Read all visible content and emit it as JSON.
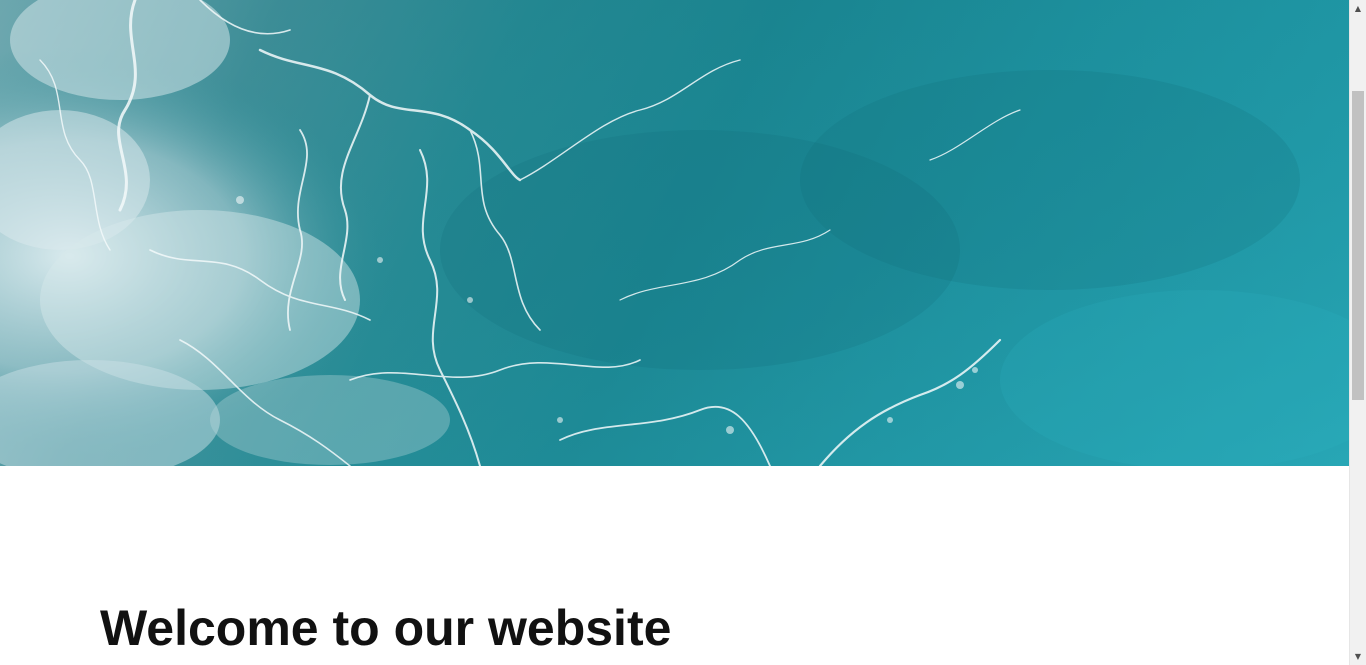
{
  "page": {
    "heading": "Welcome to our website"
  },
  "hero": {
    "image_subject": "aerial view of turquoise ocean waves with white foam"
  },
  "scrollbar": {
    "up_icon": "scroll-up-arrow",
    "down_icon": "scroll-down-arrow",
    "up_glyph": "▲",
    "down_glyph": "▼",
    "scroll_position": 0.23,
    "thumb_fraction": 0.49
  },
  "colors": {
    "ocean_deep": "#1d8a96",
    "ocean_light": "#23a1b0",
    "foam": "#e8f3f6",
    "heading_text": "#111111",
    "scrollbar_track": "#f1f1f1",
    "scrollbar_thumb": "#c1c1c1"
  }
}
